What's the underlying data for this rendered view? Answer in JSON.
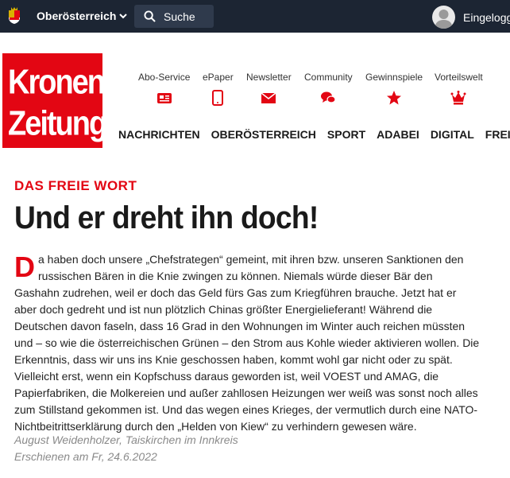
{
  "topbar": {
    "region_label": "Oberösterreich",
    "search_label": "Suche",
    "user_label": "Eingeloggt"
  },
  "logo": {
    "line1": "Kronen",
    "line2": "Zeitung"
  },
  "services": [
    {
      "label": "Abo-Service",
      "icon": "card-icon"
    },
    {
      "label": "ePaper",
      "icon": "tablet-icon"
    },
    {
      "label": "Newsletter",
      "icon": "mail-icon"
    },
    {
      "label": "Community",
      "icon": "chat-icon"
    },
    {
      "label": "Gewinnspiele",
      "icon": "star-icon"
    },
    {
      "label": "Vorteilswelt",
      "icon": "crown-icon"
    }
  ],
  "nav": [
    "NACHRICHTEN",
    "OBERÖSTERREICH",
    "SPORT",
    "ADABEI",
    "DIGITAL",
    "FREIZEIT"
  ],
  "article": {
    "kicker": "DAS FREIE WORT",
    "headline": "Und er dreht ihn doch!",
    "dropcap": "D",
    "body": "a haben doch unsere „Chefstrategen“ gemeint, mit ihren bzw. unseren Sanktionen den russischen Bären in die Knie zwingen zu können. Niemals würde dieser Bär den Gashahn zudrehen, weil er doch das Geld fürs Gas zum Kriegführen brauche. Jetzt hat er aber doch gedreht und ist nun plötzlich Chinas größter Energielieferant! Während die Deutschen davon faseln, dass 16 Grad in den Wohnungen im Winter auch reichen müssten und – so wie die österreichischen Grünen – den Strom aus Kohle wieder aktivieren wollen. Die Erkenntnis, dass wir uns ins Knie geschossen haben, kommt wohl gar nicht oder zu spät. Vielleicht erst, wenn ein Kopfschuss daraus geworden ist, weil VOEST und AMAG, die Papierfabriken, die Molkereien und außer zahllosen Heizungen wer weiß was sonst noch alles zum Stillstand gekommen ist. Und das wegen eines Krieges, der vermutlich durch eine NATO-Nichtbeitrittserklärung durch den „Helden von Kiew“ zu verhindern gewesen wäre.",
    "author": "August Weidenholzer, Taiskirchen im Innkreis",
    "date": "Erschienen am Fr, 24.6.2022"
  },
  "colors": {
    "brand_red": "#e30613",
    "topbar": "#1c2533"
  }
}
